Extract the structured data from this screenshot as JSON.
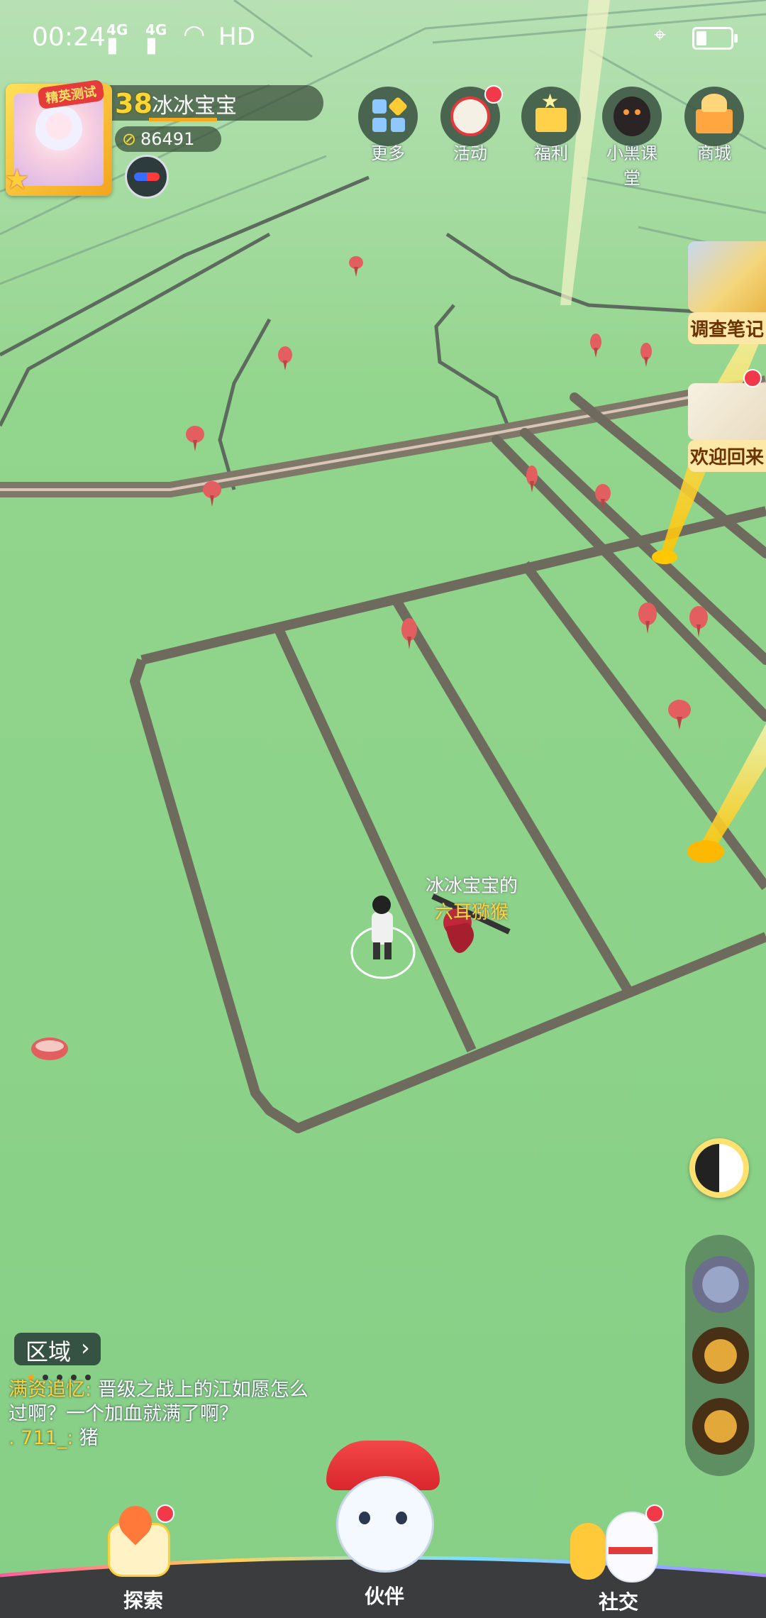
{
  "status_bar": {
    "time": "00:24",
    "signal1": "4G",
    "signal2": "4G",
    "hd": "HD"
  },
  "player": {
    "level": "38",
    "name": "冰冰宝宝",
    "coins": "86491",
    "avatar_tag": "精英测试"
  },
  "top_menu": [
    {
      "label": "更多",
      "icon": "grid-icon",
      "badge": false
    },
    {
      "label": "活动",
      "icon": "lion-mask-icon",
      "badge": true
    },
    {
      "label": "福利",
      "icon": "gift-box-icon",
      "badge": false
    },
    {
      "label": "小黑课堂",
      "icon": "black-creature-icon",
      "badge": false
    },
    {
      "label": "商城",
      "icon": "shop-icon",
      "badge": false
    }
  ],
  "side_cards": [
    {
      "label": "调查笔记",
      "badge": false
    },
    {
      "label": "欢迎回来",
      "badge": true
    }
  ],
  "map": {
    "player_owner_label": "冰冰宝宝的",
    "pet_name_label": "六耳猕猴"
  },
  "chat": {
    "region_button": "区域",
    "messages": [
      {
        "user": "满资追忆:",
        "text": "晋级之战上的江如愿怎么过啊？一个加血就满了啊？"
      },
      {
        "user": ". 711_:",
        "text": "猪"
      }
    ]
  },
  "bottom_nav": {
    "explore": "探索",
    "partner": "伙伴",
    "social": "社交"
  },
  "colors": {
    "map_green": "#8fd48a",
    "road": "#6f6a5e",
    "accent_yellow": "#ffd531",
    "badge_red": "#f2394a"
  }
}
